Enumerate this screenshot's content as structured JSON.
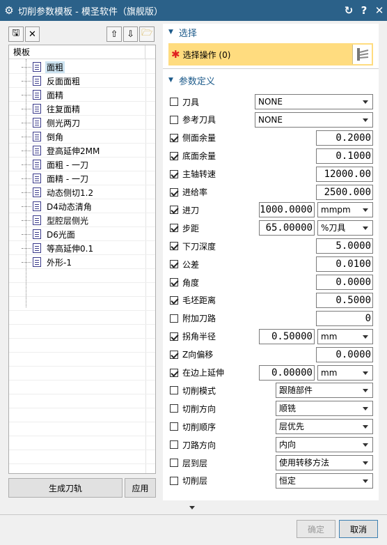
{
  "window": {
    "title": "切削参数模板 - 模圣软件（旗舰版）",
    "icons": [
      "gear-icon",
      "reset-icon",
      "help-icon",
      "close-icon"
    ]
  },
  "toolbar": {
    "icons": [
      "save-icon",
      "delete-icon",
      "move-up-icon",
      "move-down-icon",
      "open-folder-icon"
    ]
  },
  "tree": {
    "header": "模板",
    "items": [
      "面粗",
      "反面面粗",
      "面精",
      "往复面精",
      "侧光两刀",
      "倒角",
      "登高延伸2MM",
      "面粗 - 一刀",
      "面精 - 一刀",
      "动态侧切1.2",
      "D4动态清角",
      "型腔层侧光",
      "D6光面",
      "等高延伸0.1",
      "外形-1"
    ],
    "selected_index": 0
  },
  "left_buttons": {
    "generate": "生成刀轨",
    "apply": "应用"
  },
  "select_section": {
    "title": "选择",
    "operation": "选择操作 (0)"
  },
  "param_section": {
    "title": "参数定义"
  },
  "params": [
    {
      "label": "刀具",
      "checked": false,
      "dropdown": "NONE"
    },
    {
      "label": "参考刀具",
      "checked": false,
      "dropdown": "NONE"
    },
    {
      "label": "侧面余量",
      "checked": true,
      "value": "0.2000"
    },
    {
      "label": "底面余量",
      "checked": true,
      "value": "0.1000"
    },
    {
      "label": "主轴转速",
      "checked": true,
      "value": "12000.00"
    },
    {
      "label": "进给率",
      "checked": true,
      "value": "2500.000"
    },
    {
      "label": "进刀",
      "checked": true,
      "value": "1000.0000",
      "unit": "mmpm"
    },
    {
      "label": "步距",
      "checked": true,
      "value": "65.00000",
      "unit": "%刀具"
    },
    {
      "label": "下刀深度",
      "checked": true,
      "value": "5.0000"
    },
    {
      "label": "公差",
      "checked": true,
      "value": "0.0100"
    },
    {
      "label": "角度",
      "checked": true,
      "value": "0.0000"
    },
    {
      "label": "毛坯距离",
      "checked": true,
      "value": "0.5000"
    },
    {
      "label": "附加刀路",
      "checked": false,
      "value": "0"
    },
    {
      "label": "拐角半径",
      "checked": true,
      "value": "0.50000",
      "unit": "mm"
    },
    {
      "label": "Z向偏移",
      "checked": true,
      "value": "0.0000"
    },
    {
      "label": "在边上延伸",
      "checked": true,
      "value": "0.00000",
      "unit": "mm"
    },
    {
      "label": "切削模式",
      "checked": false,
      "option": "跟随部件"
    },
    {
      "label": "切削方向",
      "checked": false,
      "option": "顺铣"
    },
    {
      "label": "切削顺序",
      "checked": false,
      "option": "层优先"
    },
    {
      "label": "刀路方向",
      "checked": false,
      "option": "内向"
    },
    {
      "label": "层到层",
      "checked": false,
      "option": "使用转移方法"
    },
    {
      "label": "切削层",
      "checked": false,
      "option": "恒定"
    }
  ],
  "dialog_buttons": {
    "ok": "确定",
    "cancel": "取消"
  },
  "colors": {
    "titlebar": "#2b6189",
    "selection": "#cde4f2",
    "select_bar": "#ffdc7f",
    "accent": "#1c5a8a"
  }
}
